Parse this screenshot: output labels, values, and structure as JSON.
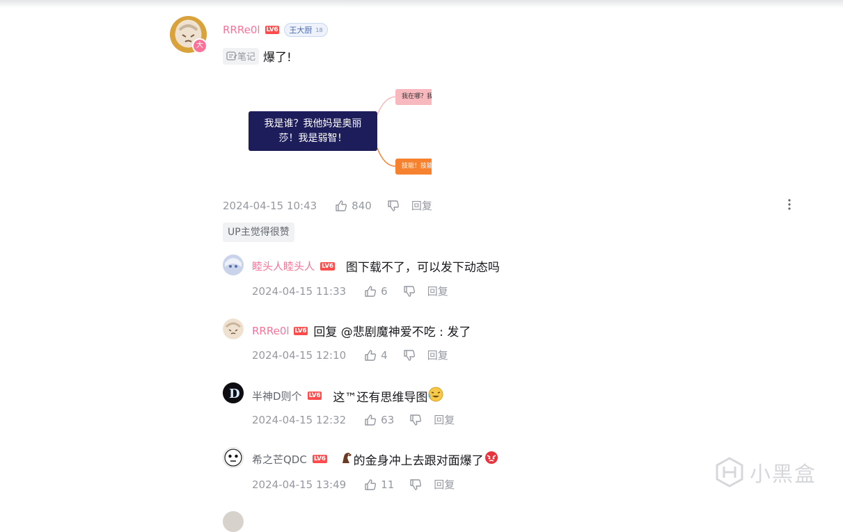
{
  "main_comment": {
    "username": "RRRe0l",
    "level": "LV6",
    "fan_badge": {
      "name": "王大厨",
      "level": "18"
    },
    "avatar_badge": "大",
    "note_label": "笔记",
    "content": "爆了!",
    "mindmap": {
      "center": "我是谁？我他妈是奥丽莎！我是弱智！",
      "branch_top": "我在哪？我",
      "branch_bottom": "技能！技能"
    },
    "time": "2024-04-15 10:43",
    "likes": "840",
    "reply_label": "回复",
    "up_tag": "UP主觉得很赞"
  },
  "replies": [
    {
      "username": "睦头人睦头人",
      "level": "LV6",
      "content": "图下载不了，可以发下动态吗",
      "time": "2024-04-15 11:33",
      "likes": "6",
      "reply_label": "回复"
    },
    {
      "username": "RRRe0l",
      "level": "LV6",
      "content": "回复 @悲剧魔神爱不吃 : 发了",
      "time": "2024-04-15 12:10",
      "likes": "4",
      "reply_label": "回复"
    },
    {
      "username": "半神D则个",
      "level": "LV6",
      "content": "这™还有思维导图",
      "time": "2024-04-15 12:32",
      "likes": "63",
      "reply_label": "回复"
    },
    {
      "username": "希之芒QDC",
      "level": "LV6",
      "content": "的金身冲上去跟对面爆了",
      "time": "2024-04-15 13:49",
      "likes": "11",
      "reply_label": "回复"
    }
  ],
  "watermark": "小黑盒"
}
